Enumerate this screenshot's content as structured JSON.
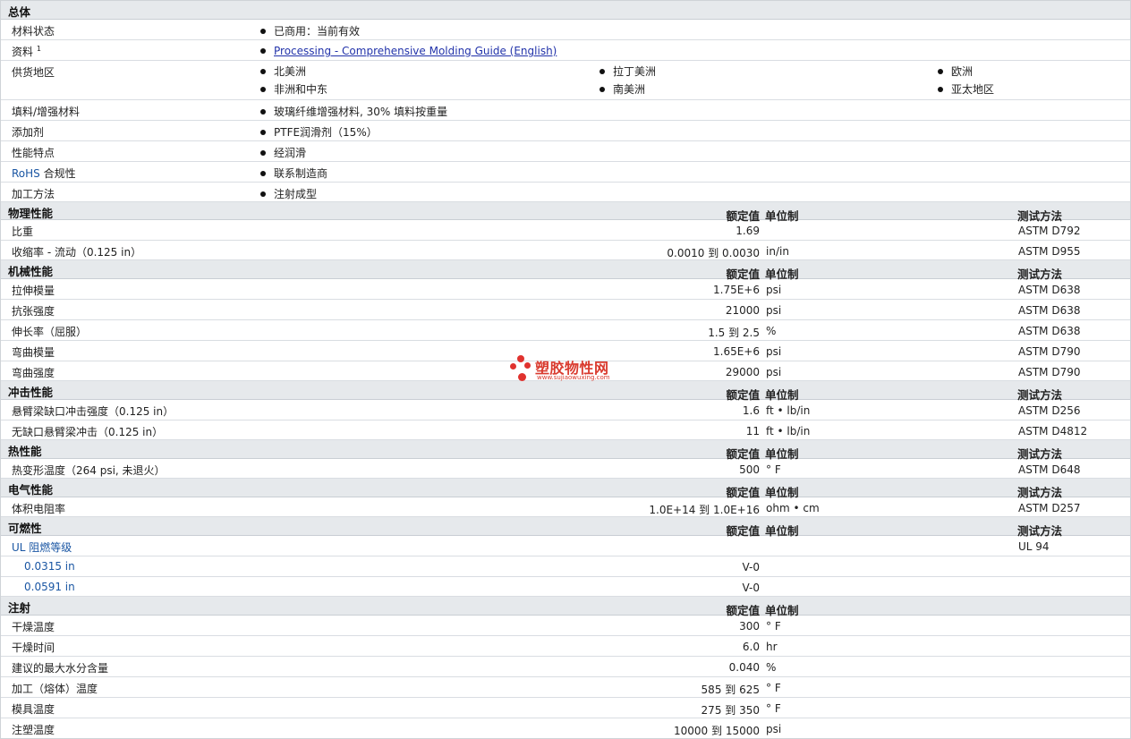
{
  "general": {
    "title": "总体",
    "status_label": "材料状态",
    "status_value": "已商用：当前有效",
    "docs_label": "资料",
    "docs_sup": "1",
    "docs_link": "Processing - Comprehensive Molding Guide (English)",
    "region_label": "供货地区",
    "regions": [
      "北美洲",
      "拉丁美洲",
      "欧洲",
      "非洲和中东",
      "南美洲",
      "亚太地区"
    ],
    "filler_label": "填料/增强材料",
    "filler_value": "玻璃纤维增强材料, 30% 填料按重量",
    "additive_label": "添加剂",
    "additive_value": "PTFE润滑剂（15%）",
    "feature_label": "性能特点",
    "feature_value": "经润滑",
    "rohs_label_a": "RoHS",
    "rohs_label_b": " 合规性",
    "rohs_value": "联系制造商",
    "process_label": "加工方法",
    "process_value": "注射成型"
  },
  "headers": {
    "value": "额定值",
    "unit": "单位制",
    "test": "测试方法"
  },
  "physical": {
    "title": "物理性能",
    "rows": [
      {
        "label": "比重",
        "value": "1.69",
        "unit": "",
        "test": "ASTM D792"
      },
      {
        "label": "收缩率 - 流动（0.125 in）",
        "value": "0.0010 到  0.0030",
        "unit": "in/in",
        "test": "ASTM D955"
      }
    ]
  },
  "mechanical": {
    "title": "机械性能",
    "rows": [
      {
        "label": "拉伸模量",
        "value": "1.75E+6",
        "unit": "psi",
        "test": "ASTM D638"
      },
      {
        "label": "抗张强度",
        "value": "21000",
        "unit": "psi",
        "test": "ASTM D638"
      },
      {
        "label": "伸长率（屈服）",
        "value": "1.5 到  2.5",
        "unit": "%",
        "test": "ASTM D638"
      },
      {
        "label": "弯曲模量",
        "value": "1.65E+6",
        "unit": "psi",
        "test": "ASTM D790"
      },
      {
        "label": "弯曲强度",
        "value": "29000",
        "unit": "psi",
        "test": "ASTM D790"
      }
    ]
  },
  "impact": {
    "title": "冲击性能",
    "rows": [
      {
        "label": "悬臂梁缺口冲击强度（0.125 in）",
        "value": "1.6",
        "unit": "ft • lb/in",
        "test": "ASTM D256"
      },
      {
        "label": "无缺口悬臂梁冲击（0.125 in）",
        "value": "11",
        "unit": "ft • lb/in",
        "test": "ASTM D4812"
      }
    ]
  },
  "thermal": {
    "title": "热性能",
    "rows": [
      {
        "label": "热变形温度（264 psi, 未退火）",
        "value": "500",
        "unit": "° F",
        "test": "ASTM D648"
      }
    ]
  },
  "electrical": {
    "title": "电气性能",
    "rows": [
      {
        "label": "体积电阻率",
        "value": "1.0E+14 到  1.0E+16",
        "unit": "ohm • cm",
        "test": "ASTM D257"
      }
    ]
  },
  "flammability": {
    "title": "可燃性",
    "ul_label": "UL 阻燃等级",
    "ul_test": "UL 94",
    "rows": [
      {
        "label": "0.0315 in",
        "value": "V-0"
      },
      {
        "label": "0.0591 in",
        "value": "V-0"
      }
    ]
  },
  "injection": {
    "title": "注射",
    "rows": [
      {
        "label": "干燥温度",
        "value": "300",
        "unit": "° F"
      },
      {
        "label": "干燥时间",
        "value": "6.0",
        "unit": "hr"
      },
      {
        "label": "建议的最大水分含量",
        "value": "0.040",
        "unit": "%"
      },
      {
        "label": "加工（熔体）温度",
        "value": "585 到  625",
        "unit": "° F"
      },
      {
        "label": "模具温度",
        "value": "275 到  350",
        "unit": "° F"
      },
      {
        "label": "注塑温度",
        "value": "10000 到  15000",
        "unit": "psi"
      }
    ]
  },
  "watermark": {
    "name": "塑胶物性网",
    "url": "www.sujiaowuxing.com"
  },
  "colors": {
    "section_bg": "#e6e9ec",
    "label_blue": "#1a56a3",
    "logo_red": "#e0322e"
  }
}
